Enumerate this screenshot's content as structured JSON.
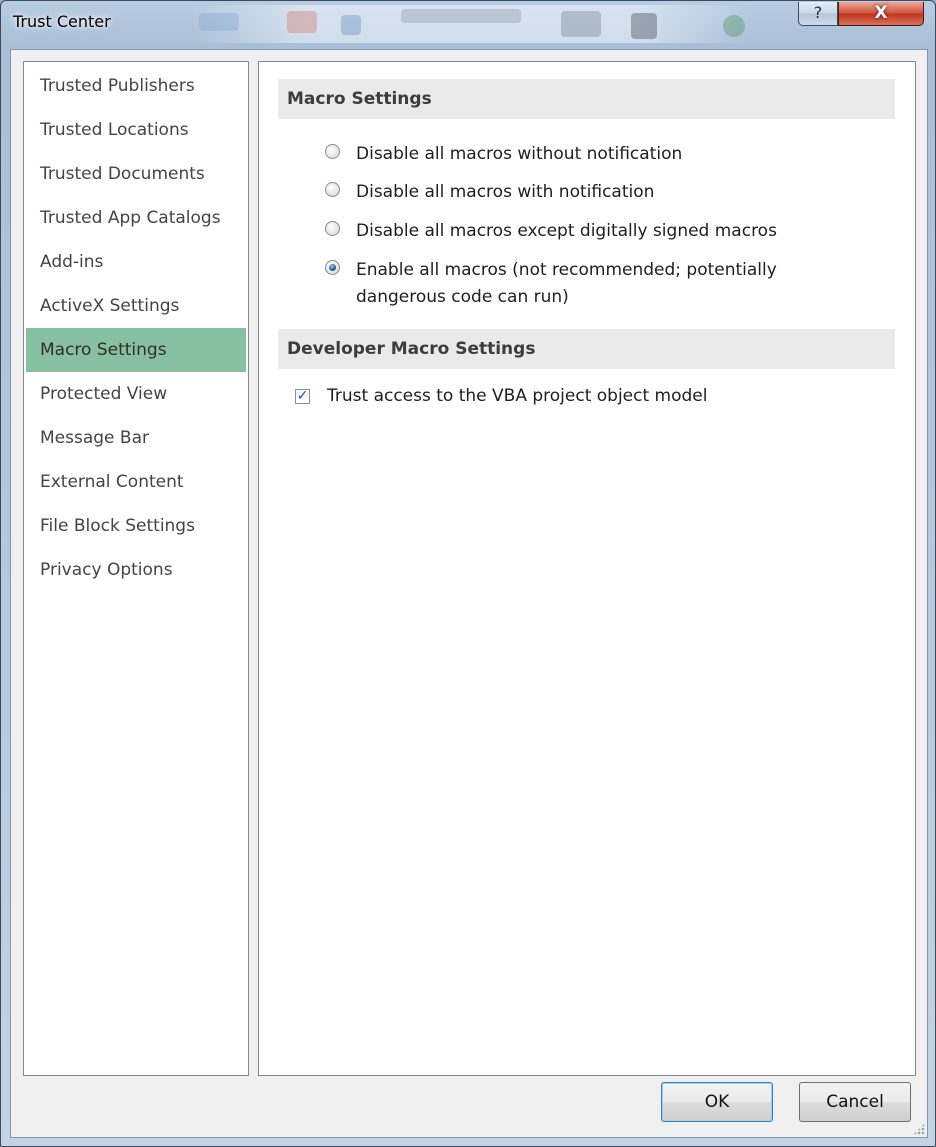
{
  "window": {
    "title": "Trust Center",
    "help_glyph": "?",
    "close_glyph": "X"
  },
  "sidebar": {
    "items": [
      {
        "label": "Trusted Publishers"
      },
      {
        "label": "Trusted Locations"
      },
      {
        "label": "Trusted Documents"
      },
      {
        "label": "Trusted App Catalogs"
      },
      {
        "label": "Add-ins"
      },
      {
        "label": "ActiveX Settings"
      },
      {
        "label": "Macro Settings",
        "selected": true
      },
      {
        "label": "Protected View"
      },
      {
        "label": "Message Bar"
      },
      {
        "label": "External Content"
      },
      {
        "label": "File Block Settings"
      },
      {
        "label": "Privacy Options"
      }
    ],
    "selected_color": "#87c0a2"
  },
  "macro_settings": {
    "header": "Macro Settings",
    "options": [
      {
        "label": "Disable all macros without notification",
        "checked": false
      },
      {
        "label": "Disable all macros with notification",
        "checked": false
      },
      {
        "label": "Disable all macros except digitally signed macros",
        "checked": false
      },
      {
        "label": "Enable all macros (not recommended; potentially dangerous code can run)",
        "checked": true
      }
    ]
  },
  "developer_settings": {
    "header": "Developer Macro Settings",
    "trust_vba_label": "Trust access to the VBA project object model",
    "trust_vba_checked": true
  },
  "buttons": {
    "ok": "OK",
    "cancel": "Cancel"
  },
  "colors": {
    "accent": "#87c0a2",
    "section_header_bg": "#eaeaea"
  }
}
